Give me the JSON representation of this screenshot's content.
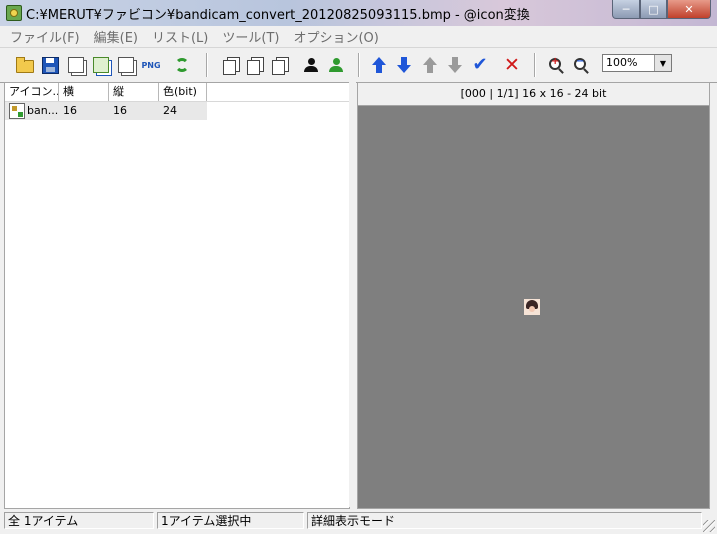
{
  "window": {
    "title": "C:¥MERUT¥ファビコン¥bandicam_convert_20120825093115.bmp - @icon変換",
    "controls": {
      "minimize": "─",
      "maximize": "□",
      "close": "✕"
    }
  },
  "menu": [
    {
      "label": "ファイル(F)"
    },
    {
      "label": "編集(E)"
    },
    {
      "label": "リスト(L)"
    },
    {
      "label": "ツール(T)"
    },
    {
      "label": "オプション(O)"
    }
  ],
  "toolbar": {
    "png_label": "PNG",
    "check_glyph": "✔",
    "delete_glyph": "✕",
    "zoom_in_sign": "+",
    "zoom_out_sign": "−",
    "zoom": {
      "value": "100%",
      "arrow": "▼"
    }
  },
  "list": {
    "columns": [
      "アイコン...",
      "横",
      "縦",
      "色(bit)"
    ],
    "rows": [
      {
        "name": "ban...",
        "width": "16",
        "height": "16",
        "bits": "24"
      }
    ]
  },
  "preview": {
    "info": "[000 | 1/1] 16 x 16 - 24 bit"
  },
  "status": {
    "total": "全 1アイテム",
    "selected": "1アイテム選択中",
    "mode": "詳細表示モード"
  },
  "colors": {
    "preview_background": "#7f7f7f",
    "selected_row": "#e8e8e8",
    "arrow_blue": "#1f56d8",
    "delete_red": "#d01818"
  }
}
